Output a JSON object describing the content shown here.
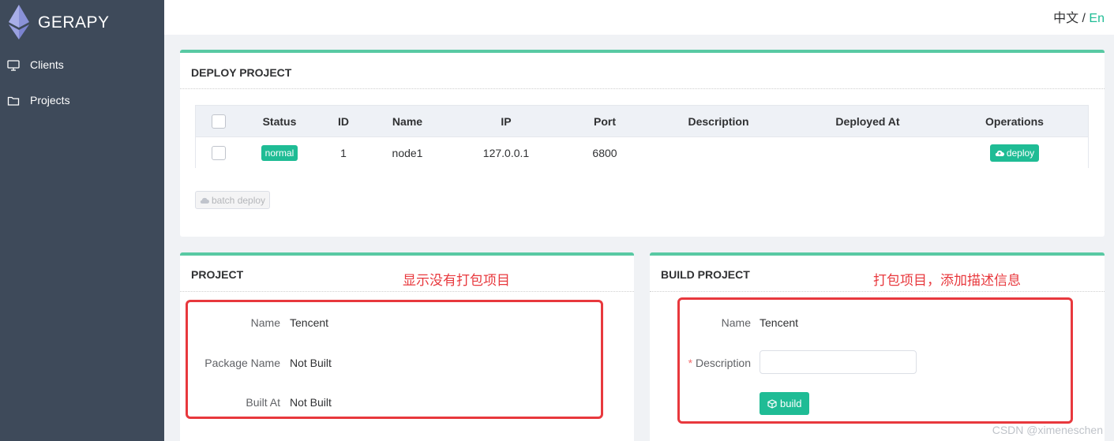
{
  "app": {
    "brand": "GERAPY"
  },
  "sidebar": {
    "items": [
      {
        "label": "Clients",
        "icon": "monitor-icon"
      },
      {
        "label": "Projects",
        "icon": "folder-icon"
      }
    ]
  },
  "topbar": {
    "lang_zh": "中文",
    "lang_sep": " / ",
    "lang_en": "En"
  },
  "deploy": {
    "title": "DEPLOY PROJECT",
    "columns": [
      "Status",
      "ID",
      "Name",
      "IP",
      "Port",
      "Description",
      "Deployed At",
      "Operations"
    ],
    "rows": [
      {
        "status": "normal",
        "id": "1",
        "name": "node1",
        "ip": "127.0.0.1",
        "port": "6800",
        "description": "",
        "deployed_at": "",
        "operation": "deploy"
      }
    ],
    "batch_label": "batch deploy"
  },
  "project": {
    "title": "PROJECT",
    "annotation": "显示没有打包项目",
    "fields": [
      {
        "label": "Name",
        "value": "Tencent"
      },
      {
        "label": "Package Name",
        "value": "Not Built"
      },
      {
        "label": "Built At",
        "value": "Not Built"
      }
    ]
  },
  "build": {
    "title": "BUILD PROJECT",
    "annotation": "打包项目，添加描述信息",
    "name_label": "Name",
    "name_value": "Tencent",
    "required_mark": "*",
    "description_label": "Description",
    "description_value": "",
    "build_label": "build"
  },
  "watermark": "CSDN @ximeneschen",
  "colors": {
    "accent": "#1fbc95",
    "sidebar": "#3e4a5a",
    "annotation": "#e8383d"
  }
}
